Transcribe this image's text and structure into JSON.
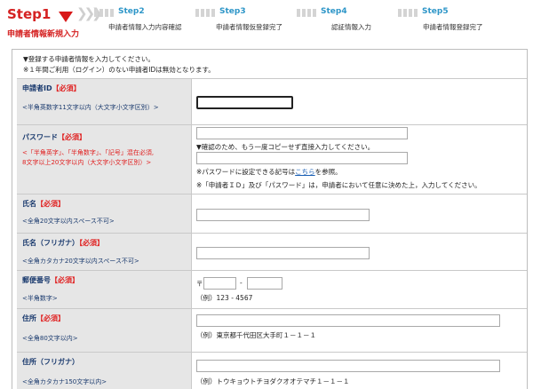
{
  "steps": {
    "current": {
      "number": "Step1",
      "desc": "申請者情報新規入力"
    },
    "items": [
      {
        "number": "Step2",
        "desc": "申請者情報入力内容確認"
      },
      {
        "number": "Step3",
        "desc": "申請者情報仮登録完了"
      },
      {
        "number": "Step4",
        "desc": "認証情報入力"
      },
      {
        "number": "Step5",
        "desc": "申請者情報登録完了"
      }
    ]
  },
  "notice": {
    "line1": "▼登録する申請者情報を入力してください。",
    "line2": "※１年間ご利用（ログイン）のない申請者IDは無効となります。"
  },
  "required_mark": "【必須】",
  "fields": {
    "applicant_id": {
      "label": "申請者ID",
      "hint": "<半角英数字11文字以内（大文字小文字区別）>",
      "value": ""
    },
    "password": {
      "label": "パスワード",
      "hint1": "<「半角英字」、「半角数字」、「記号」混在必須,",
      "hint2": "8文字以上20文字以内（大文字小文字区別）>",
      "confirm_note": "▼確認のため、もう一度コピーせず直接入力してください。",
      "symbol_note_pre": "※パスワードに設定できる記号は",
      "symbol_link": "こちら",
      "symbol_note_post": "を参照。",
      "decide_note": "※「申請者ＩＤ」及び「パスワード」は，申請者において任意に決めた上，入力してください。"
    },
    "name": {
      "label": "氏名",
      "hint": "<全角20文字以内スペース不可>"
    },
    "name_kana": {
      "label": "氏名（フリガナ）",
      "hint": "<全角カタカナ20文字以内スペース不可>"
    },
    "postal": {
      "label": "郵便番号",
      "hint": "<半角数字>",
      "prefix": "〒",
      "dash": "-",
      "example": "（例）123 - 4567"
    },
    "address": {
      "label": "住所",
      "hint": "<全角80文字以内>",
      "example": "（例）東京都千代田区大手町１－１－１"
    },
    "address_kana": {
      "label": "住所（フリガナ）",
      "hint": "<全角カタカナ150文字以内>",
      "example": "（例）トウキョウトチヨダクオオテマチ１－１－１"
    }
  }
}
